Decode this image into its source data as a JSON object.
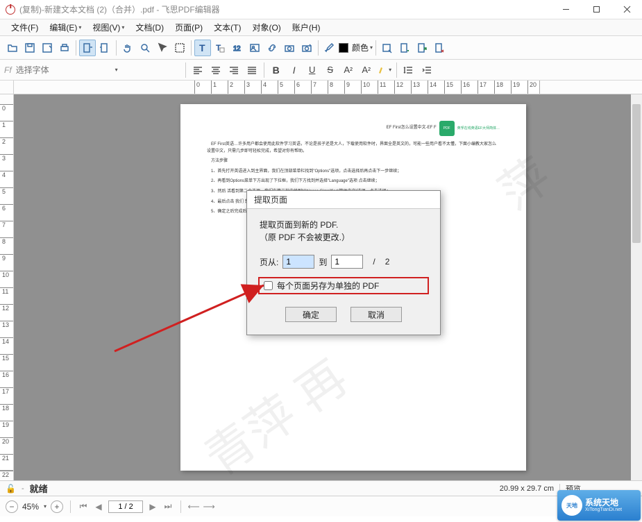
{
  "window": {
    "title": "(复制)-新建文本文档 (2)（合并）.pdf - 飞思PDF编辑器"
  },
  "menu": [
    {
      "label": "文件",
      "accel": "(F)"
    },
    {
      "label": "编辑",
      "accel": "(E)"
    },
    {
      "label": "视图",
      "accel": "(V)"
    },
    {
      "label": "文档",
      "accel": "(D)"
    },
    {
      "label": "页面",
      "accel": "(P)"
    },
    {
      "label": "文本",
      "accel": "(T)"
    },
    {
      "label": "对象",
      "accel": "(O)"
    },
    {
      "label": "账户",
      "accel": "(H)"
    }
  ],
  "toolbar": {
    "color_label": "颜色"
  },
  "toolbar2": {
    "font_prefix": "Ff",
    "font_placeholder": "选择字体",
    "bold": "B",
    "italic": "I",
    "underline": "U",
    "strike": "S",
    "super": "A",
    "sub": "A"
  },
  "dialog": {
    "title": "提取页面",
    "msg_line1": "提取页面到新的 PDF.",
    "msg_line2": "（原 PDF 不会被更改.）",
    "from_label": "页从:",
    "from_value": "1",
    "to_label": "到",
    "to_value": "1",
    "total_sep": "/",
    "total": "2",
    "checkbox_label": "每个页面另存为单独的 PDF",
    "ok": "确定",
    "cancel": "取消"
  },
  "status": {
    "ready": "就绪",
    "dims": "20.99 x 29.7 cm",
    "preview": "预览"
  },
  "bottombar": {
    "zoom": "45%",
    "page": "1 / 2"
  },
  "brand": {
    "name": "系统天地",
    "url": "XiTongTianDi.net"
  },
  "page_text": {
    "hdr_left": "",
    "hdr_right": "EF First怎么设置中文-EF F",
    "hdr_badge_sub": "英孚在线英语EF大师简体…",
    "body": [
      "EF First英语…许多用户都会使用此软件学习英语，不论是孩子还是大人，下载使用软件时，界面全是英文的，可能一些用户看不太懂，下面小编教大家怎么设置中文，只需几步即可轻松完成，希望对你有帮助。",
      "方法步骤",
      "1、首先打开英语进入到主界面，我们在顶部菜单栏找到\"Options\"选项，点击选择后再点击下一步继续；",
      "2、再看到Options菜单下方出现了下拉框，我们下方找到并选择\"Language\"选项 点击继续；",
      "3、然后 活看到第二个选项，我们在第二栏中找到\"Chinese Simplified/简体中文\"选项，点击选择；",
      "4、最后点击 我们 想要选用的语言后就会弹出一个选项框询问我们是否就是改更改，点击确定；",
      "5、确定之后完成后 我们就成功的将英语软件的语言设置到简体中文了 是不是很简单 点击完成即可结束。"
    ]
  },
  "ruler": {
    "h_ticks": [
      0,
      1,
      2,
      3,
      4,
      5,
      6,
      7,
      8,
      9,
      10,
      11,
      12,
      13,
      14,
      15,
      16,
      17,
      18,
      19,
      20
    ],
    "v_ticks": [
      0,
      1,
      2,
      3,
      4,
      5,
      6,
      7,
      8,
      9,
      10,
      11,
      12,
      13,
      14,
      15,
      16,
      17,
      18,
      19,
      20,
      21,
      22
    ]
  }
}
